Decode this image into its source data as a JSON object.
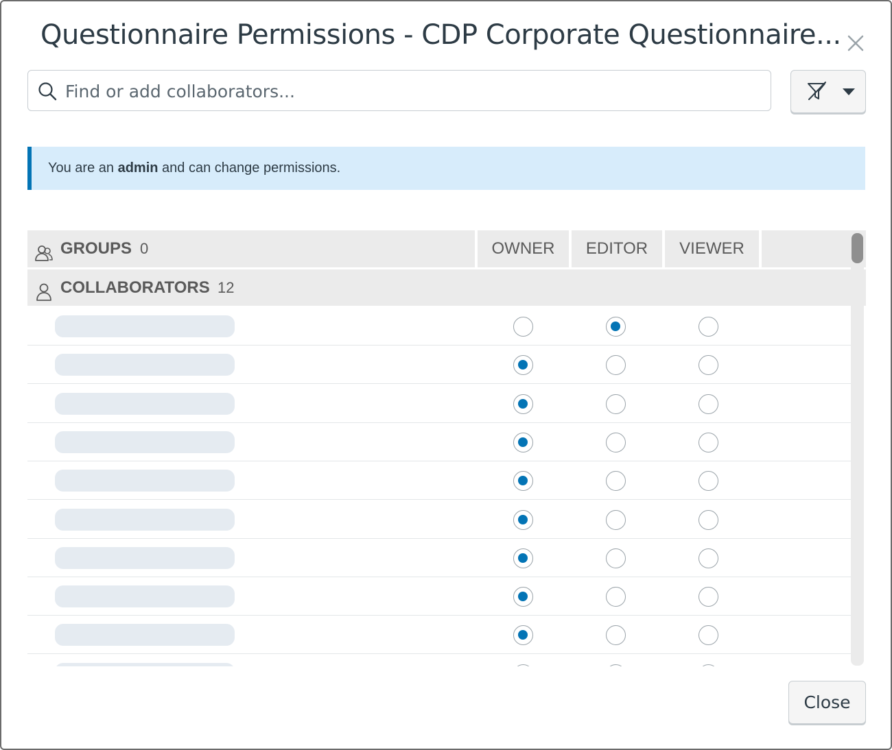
{
  "dialog": {
    "title": "Questionnaire Permissions - CDP Corporate Questionnaire...",
    "close_icon": "close-x-icon"
  },
  "search": {
    "placeholder": "Find or add collaborators...",
    "value": "",
    "icon": "search-icon"
  },
  "filter": {
    "icon": "filter-off-icon",
    "caret_icon": "chevron-down-icon"
  },
  "alert": {
    "prefix": "You are an",
    "role": "admin",
    "suffix": "and can change permissions.",
    "accent_color": "#0374b5",
    "background_color": "#d7ecfb"
  },
  "table": {
    "groups_label": "GROUPS",
    "groups_count": "0",
    "collaborators_label": "COLLABORATORS",
    "collaborators_count": "12",
    "columns": [
      "OWNER",
      "EDITOR",
      "VIEWER"
    ],
    "rows": [
      {
        "permission": "editor"
      },
      {
        "permission": "owner"
      },
      {
        "permission": "owner"
      },
      {
        "permission": "owner"
      },
      {
        "permission": "owner"
      },
      {
        "permission": "owner"
      },
      {
        "permission": "owner"
      },
      {
        "permission": "owner"
      },
      {
        "permission": "owner"
      },
      {
        "permission": "owner"
      }
    ],
    "radio_selected_color": "#0374b5"
  },
  "footer": {
    "close_label": "Close"
  }
}
